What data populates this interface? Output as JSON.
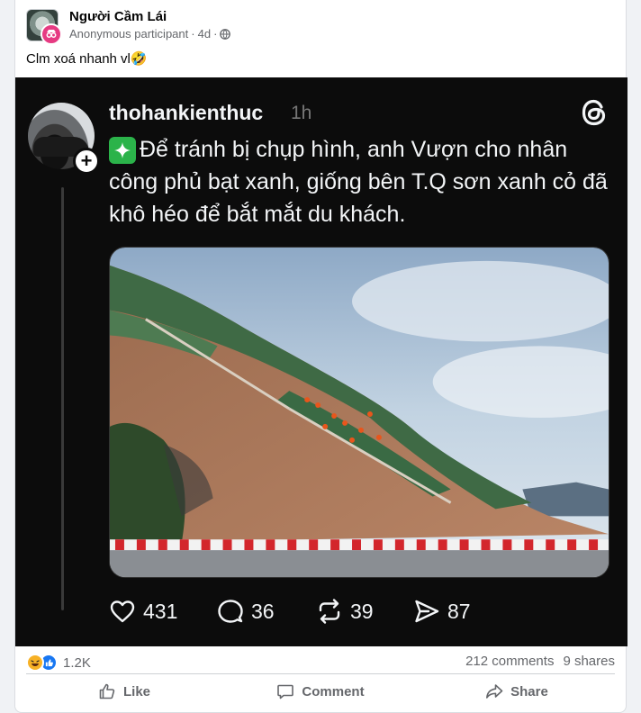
{
  "post": {
    "group_name": "Người Cầm Lái",
    "author": "Anonymous participant",
    "time": "4d",
    "caption": "Clm xoá nhanh vl🤣",
    "avatar_icon": "group-avatar",
    "visibility_icon": "globe-icon"
  },
  "threads": {
    "username": "thohankienthuc",
    "time": "1h",
    "text": "Để tránh bị chụp hình, anh Vượn cho nhân công phủ bạt xanh, giống bên T.Q sơn xanh cỏ đã khô héo để bắt mắt du khách.",
    "sparkle_icon": "sparkle-icon",
    "likes": "431",
    "comments": "36",
    "reposts": "39",
    "shares": "87"
  },
  "stats": {
    "reactions": "1.2K",
    "comments": "212 comments",
    "shares": "9 shares"
  },
  "buttons": {
    "like": "Like",
    "comment": "Comment",
    "share": "Share"
  },
  "colors": {
    "brand_blue": "#1877f2",
    "anon_pink": "#e63a82",
    "threads_bg": "#0c0c0c",
    "secondary_text": "#65676b"
  }
}
